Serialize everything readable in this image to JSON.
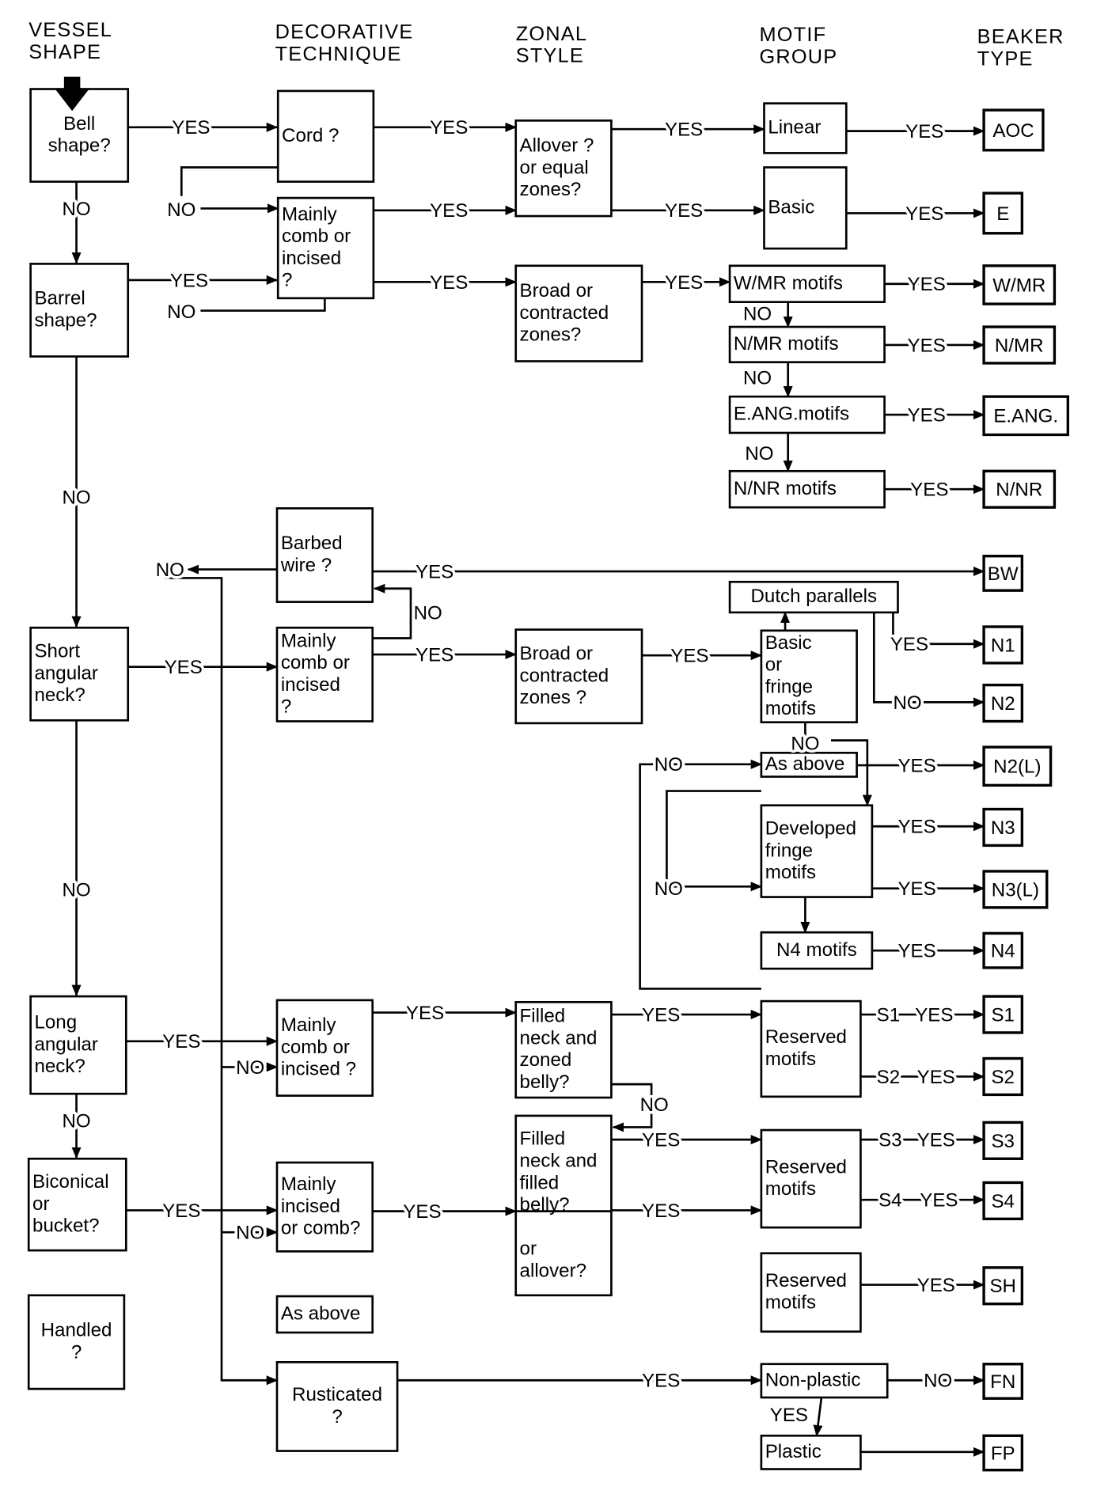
{
  "headers": [
    {
      "lines": [
        "VESSEL",
        "SHAPE"
      ]
    },
    {
      "lines": [
        "DECORATIVE",
        "TECHNIQUE"
      ]
    },
    {
      "lines": [
        "ZONAL",
        "STYLE"
      ]
    },
    {
      "lines": [
        "MOTIF",
        "GROUP"
      ]
    },
    {
      "lines": [
        "BEAKER",
        "TYPE"
      ]
    }
  ],
  "boxes": [
    {
      "lines": [
        "Bell",
        "shape?"
      ]
    },
    {
      "lines": [
        "Barrel",
        "shape?"
      ]
    },
    {
      "lines": [
        "Short",
        "angular",
        "neck?"
      ]
    },
    {
      "lines": [
        "Long",
        "angular",
        "neck?"
      ]
    },
    {
      "lines": [
        "Biconical",
        "or",
        "bucket?"
      ]
    },
    {
      "lines": [
        "Handled",
        "?"
      ]
    },
    {
      "lines": [
        "Cord ?"
      ]
    },
    {
      "lines": [
        "Mainly",
        "comb or",
        "incised",
        "?"
      ]
    },
    {
      "lines": [
        "Barbed",
        "wire ?"
      ]
    },
    {
      "lines": [
        "Mainly",
        "comb or",
        "incised",
        "?"
      ]
    },
    {
      "lines": [
        "Mainly",
        "comb or",
        "incised ?"
      ]
    },
    {
      "lines": [
        "Mainly",
        "incised",
        "or comb?"
      ]
    },
    {
      "lines": [
        "As above"
      ]
    },
    {
      "lines": [
        "Rusticated",
        "?"
      ]
    },
    {
      "lines": [
        "Allover ?",
        "or equal",
        "zones?"
      ]
    },
    {
      "lines": [
        "Broad or",
        "contracted",
        "zones?"
      ]
    },
    {
      "lines": [
        "Broad or",
        "contracted",
        "zones ?"
      ]
    },
    {
      "lines": [
        "Filled",
        "neck and",
        "zoned",
        "belly?"
      ]
    },
    {
      "lines": [
        "Filled",
        "neck and",
        "filled",
        "belly?",
        "",
        "or",
        "allover?"
      ]
    },
    {
      "lines": [
        "Linear"
      ]
    },
    {
      "lines": [
        "Basic"
      ]
    },
    {
      "lines": [
        "W/MR motifs"
      ]
    },
    {
      "lines": [
        "N/MR motifs"
      ]
    },
    {
      "lines": [
        "E.ANG.motifs"
      ]
    },
    {
      "lines": [
        "N/NR motifs"
      ]
    },
    {
      "lines": [
        "Dutch parallels"
      ]
    },
    {
      "lines": [
        "Basic",
        "or",
        "fringe",
        "motifs"
      ]
    },
    {
      "lines": [
        "As above"
      ]
    },
    {
      "lines": [
        "Developed",
        "fringe",
        "motifs"
      ]
    },
    {
      "lines": [
        "N4 motifs"
      ]
    },
    {
      "lines": [
        "Reserved",
        "motifs"
      ]
    },
    {
      "lines": [
        "Reserved",
        "motifs"
      ]
    },
    {
      "lines": [
        "Reserved",
        "motifs"
      ]
    },
    {
      "lines": [
        "Non-plastic"
      ]
    },
    {
      "lines": [
        "Plastic"
      ]
    }
  ],
  "beaker_types": [
    "AOC",
    "E",
    "W/MR",
    "N/MR",
    "E.ANG.",
    "N/NR",
    "BW",
    "N1",
    "N2",
    "N2(L)",
    "N3",
    "N3(L)",
    "N4",
    "S1",
    "S2",
    "S3",
    "S4",
    "SH",
    "FN",
    "FP"
  ],
  "edge_labels": [
    "YES",
    "YES",
    "YES",
    "YES",
    "YES",
    "YES",
    "NO",
    "",
    "YES",
    "NO",
    "YES",
    "YES",
    "NO",
    "YES",
    "YES",
    "NO",
    "YES",
    "NO",
    "YES",
    "NO",
    "YES",
    "NO",
    "YES",
    "NO",
    "",
    "NO",
    "YES",
    "YES",
    "YES",
    "",
    "YES",
    "NO",
    "NO",
    "",
    "NO",
    "YES",
    "NO",
    "NO",
    "YES",
    "YES",
    "",
    "YES",
    "YES",
    "NO",
    "YES",
    "NO",
    "YES",
    "YES",
    "NO",
    "YES",
    "YES",
    "YES",
    "NO",
    "YES",
    "YES",
    "YES",
    "YES",
    "YES",
    "YES",
    "NO",
    "YES"
  ],
  "extra_labels": [
    "S1",
    "S2",
    "S3",
    "S4"
  ]
}
